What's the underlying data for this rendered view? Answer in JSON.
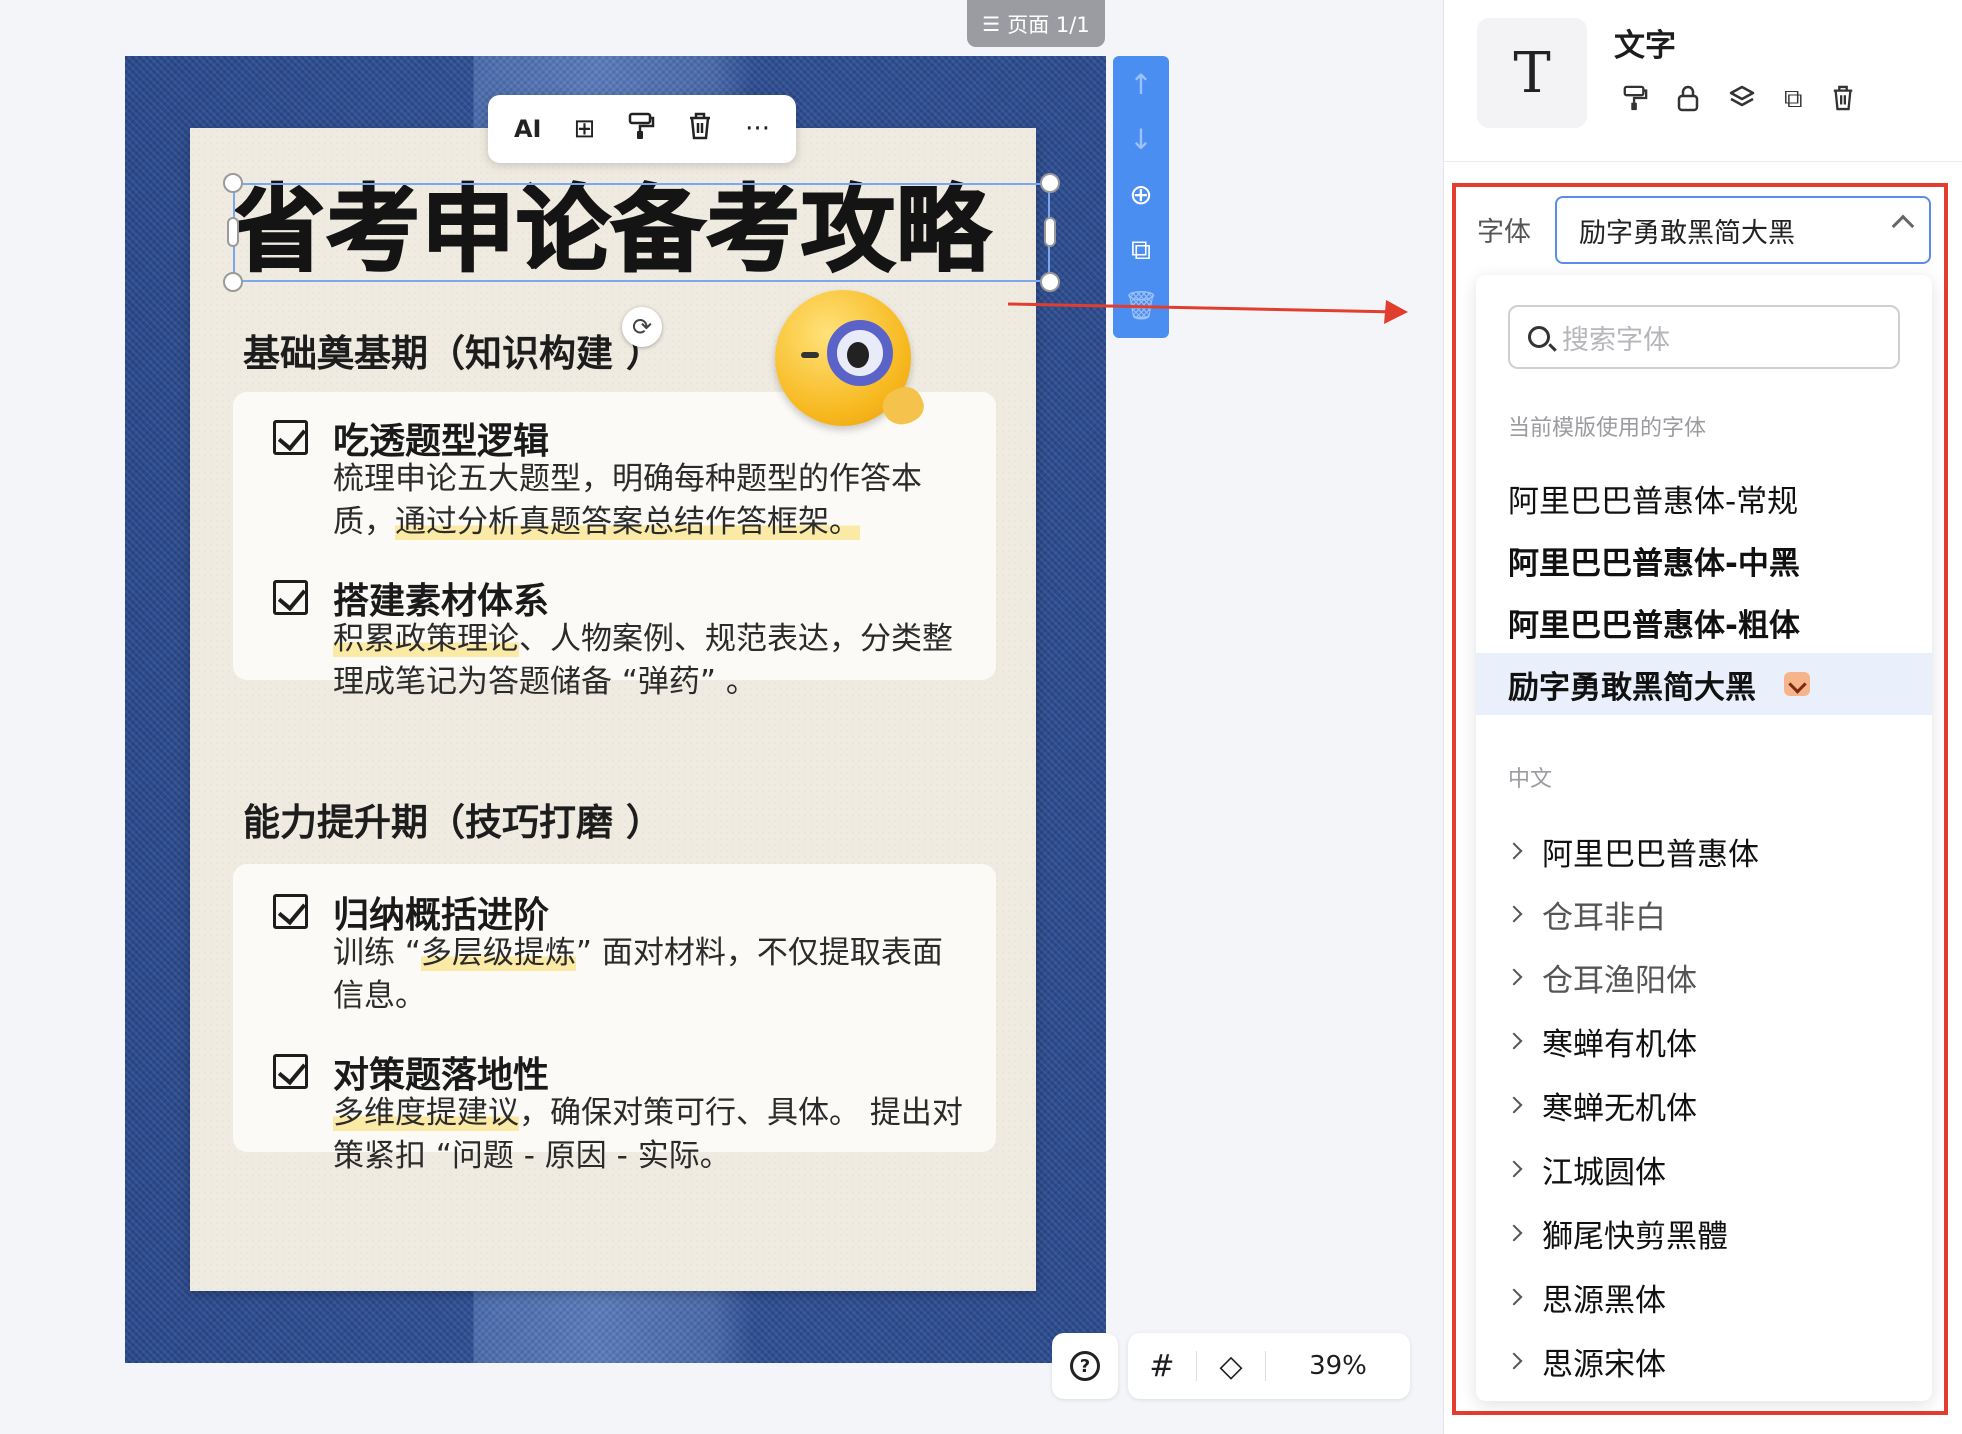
{
  "page_tag": {
    "icon": "list-icon",
    "label": "页面 1/1"
  },
  "poster": {
    "title": "省考申论备考攻略",
    "section1": {
      "title": "基础奠基期（知识构建 ）"
    },
    "card1": {
      "item1": {
        "head": "吃透题型逻辑",
        "body_a": "梳理申论五大题型，明确每种题型的作答本质，",
        "body_hl": "通过分析真题答案总结作答框架。"
      },
      "item2": {
        "head": "搭建素材体系",
        "body_hl": "积累政策理论",
        "body_b": "、人物案例、规范表达，分类整理成笔记为答题储备 “弹药” 。"
      }
    },
    "section2": {
      "title": "能力提升期（技巧打磨 ）"
    },
    "card2": {
      "item1": {
        "head": "归纳概括进阶",
        "body_a": "训练 “",
        "body_hl": "多层级提炼",
        "body_b": "” 面对材料，不仅提取表面信息。"
      },
      "item2": {
        "head": "对策题落地性",
        "body_hl": "多维度提建议",
        "body_b": "，确保对策可行、具体。 提出对策紧扣 “问题 - 原因 - 实际。"
      }
    }
  },
  "element_toolbar": {
    "ai_label": "AI",
    "icons": [
      "add-copy-icon",
      "format-brush-icon",
      "trash-icon",
      "more-icon"
    ]
  },
  "zoom": {
    "value": "39%"
  },
  "panel": {
    "title": "文字",
    "font_label": "字体",
    "selected_font": "励字勇敢黑简大黑",
    "search_placeholder": "搜索字体",
    "group_current": "当前模版使用的字体",
    "current_fonts": [
      "阿里巴巴普惠体-常规",
      "阿里巴巴普惠体-中黑",
      "阿里巴巴普惠体-粗体",
      "励字勇敢黑简大黑"
    ],
    "group_chinese": "中文",
    "families": [
      "阿里巴巴普惠体",
      "仓耳非白",
      "仓耳渔阳体",
      "寒蝉有机体",
      "寒蝉无机体",
      "江城圆体",
      "獅尾快剪黑體",
      "思源黑体",
      "思源宋体"
    ]
  },
  "colors": {
    "accent": "#4b8ef2",
    "annotation_red": "#e23e2f",
    "highlight": "#fbe9a6",
    "denim": "#2f4f93"
  }
}
